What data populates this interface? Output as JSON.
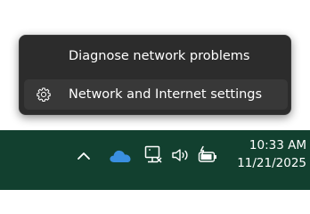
{
  "context_menu": {
    "items": [
      {
        "label": "Diagnose network problems",
        "icon": ""
      },
      {
        "label": "Network and Internet settings",
        "icon": "gear-icon"
      }
    ]
  },
  "taskbar": {
    "tray_icons": [
      "chevron-up-icon",
      "onedrive-cloud-icon",
      "network-icon",
      "volume-icon",
      "battery-charging-icon"
    ],
    "clock": {
      "time": "10:33 AM",
      "date": "11/21/2025"
    }
  },
  "colors": {
    "menu_background": "#2c2c2c",
    "menu_hover": "#383838",
    "taskbar_background": "#12402f",
    "cloud_blue": "#3a8fe0"
  }
}
